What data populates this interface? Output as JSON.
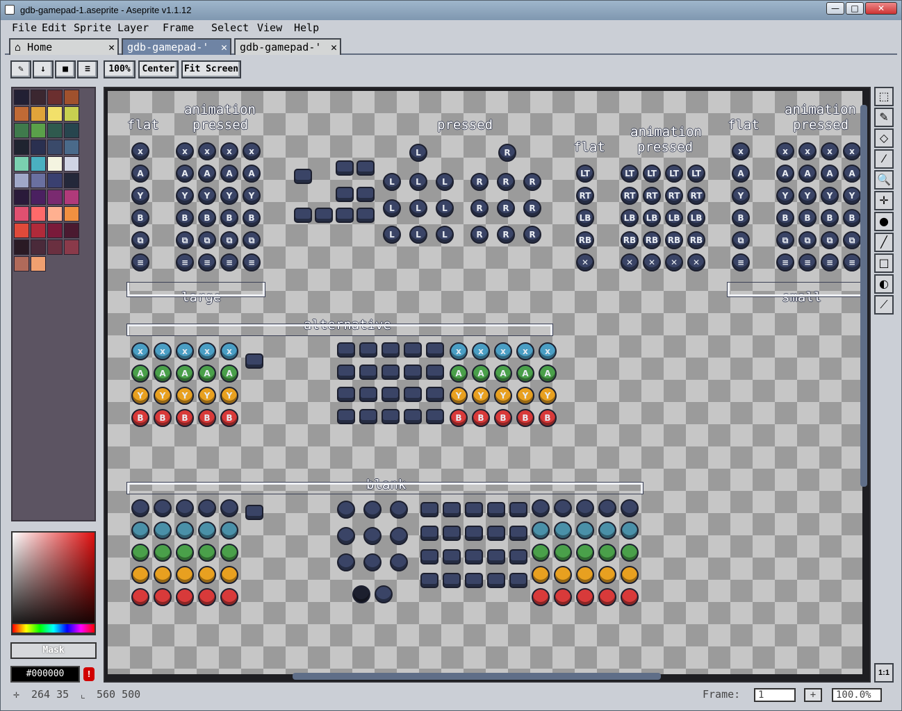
{
  "window": {
    "title": "gdb-gamepad-1.aseprite - Aseprite v1.1.12"
  },
  "menu": [
    "File",
    "Edit",
    "Sprite",
    "Layer",
    "Frame",
    "Select",
    "View",
    "Help"
  ],
  "tabs": [
    {
      "label": "Home"
    },
    {
      "label": "gdb-gamepad-'"
    },
    {
      "label": "gdb-gamepad-'"
    }
  ],
  "toolbar": {
    "zoom": "100%",
    "center": "Center",
    "fit": "Fit Screen"
  },
  "palette": [
    "#222034",
    "#3b2730",
    "#6b2f2f",
    "#a0512d",
    "#c06a35",
    "#e0a43a",
    "#f2e06a",
    "#c8d050",
    "#3f7a4c",
    "#5aa04a",
    "#2f5a4e",
    "#27454e",
    "#1f2430",
    "#2a3050",
    "#3a4a6a",
    "#4a6a8a",
    "#7ad0b0",
    "#4ab0c0",
    "#f4f4e0",
    "#d0d4e4",
    "#a0a8c8",
    "#6a70a0",
    "#3a4070",
    "#24283a",
    "#2a1a3a",
    "#4a2060",
    "#7a2a70",
    "#b03a7a",
    "#e05070",
    "#ff6a6a",
    "#ffb090",
    "#f09040",
    "#e04a3a",
    "#b02a3a",
    "#7a1a3a",
    "#4a1a30",
    "#2a1a24",
    "#4a2a3a",
    "#6a3040",
    "#8a3a4a",
    "#b06a5a",
    "#f0a070"
  ],
  "color": {
    "hex": "#000000",
    "mask": "Mask"
  },
  "canvas_labels": {
    "flat": "flat",
    "animation": "animation",
    "pressed": "pressed",
    "large": "large",
    "small": "small",
    "alternative": "alternative",
    "blank": "blank"
  },
  "button_letters": {
    "x": "x",
    "a": "A",
    "y": "Y",
    "b": "B",
    "l": "L",
    "r": "R",
    "lt": "LT",
    "rt": "RT",
    "lb": "LB",
    "rb": "RB"
  },
  "status": {
    "pos": "264 35",
    "size": "560 500",
    "frame_label": "Frame:",
    "frame": "1",
    "add": "+",
    "zoom": "100.0%"
  }
}
